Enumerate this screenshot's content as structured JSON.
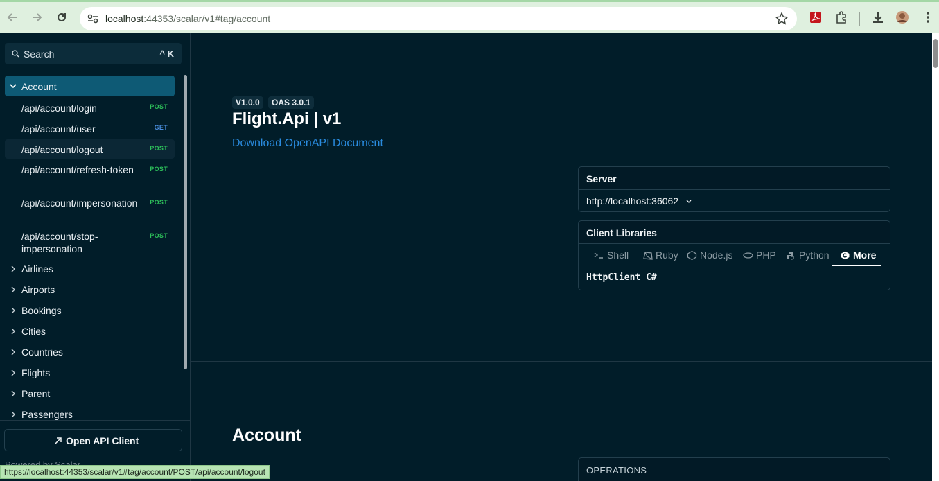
{
  "browser": {
    "url_host": "localhost",
    "url_rest": ":44353/scalar/v1#tag/account",
    "status_url": "https://localhost:44353/scalar/v1#tag/account/POST/api/account/logout"
  },
  "sidebar": {
    "search_label": "Search",
    "search_shortcut": "^ K",
    "active_tag": "Account",
    "endpoints": [
      {
        "path": "/api/account/login",
        "method": "POST"
      },
      {
        "path": "/api/account/user",
        "method": "GET"
      },
      {
        "path": "/api/account/logout",
        "method": "POST"
      },
      {
        "path": "/api/account/refresh-token",
        "method": "POST"
      },
      {
        "path": "/api/account/impersonation",
        "method": "POST"
      },
      {
        "path": "/api/account/stop-impersonation",
        "method": "POST"
      }
    ],
    "tags": [
      "Airlines",
      "Airports",
      "Bookings",
      "Cities",
      "Countries",
      "Flights",
      "Parent",
      "Passengers"
    ],
    "open_client_label": "Open API Client",
    "powered_by": "Powered by Scalar"
  },
  "main": {
    "version_badge": "V1.0.0",
    "oas_badge": "OAS 3.0.1",
    "title": "Flight.Api | v1",
    "download_label": "Download OpenAPI Document",
    "server_header": "Server",
    "server_url": "http://localhost:36062",
    "clients_header": "Client Libraries",
    "languages": [
      "Shell",
      "Ruby",
      "Node.js",
      "PHP",
      "Python",
      "More"
    ],
    "active_language": "More",
    "client_code": "HttpClient C#",
    "section_title": "Account",
    "operations_label": "OPERATIONS"
  }
}
